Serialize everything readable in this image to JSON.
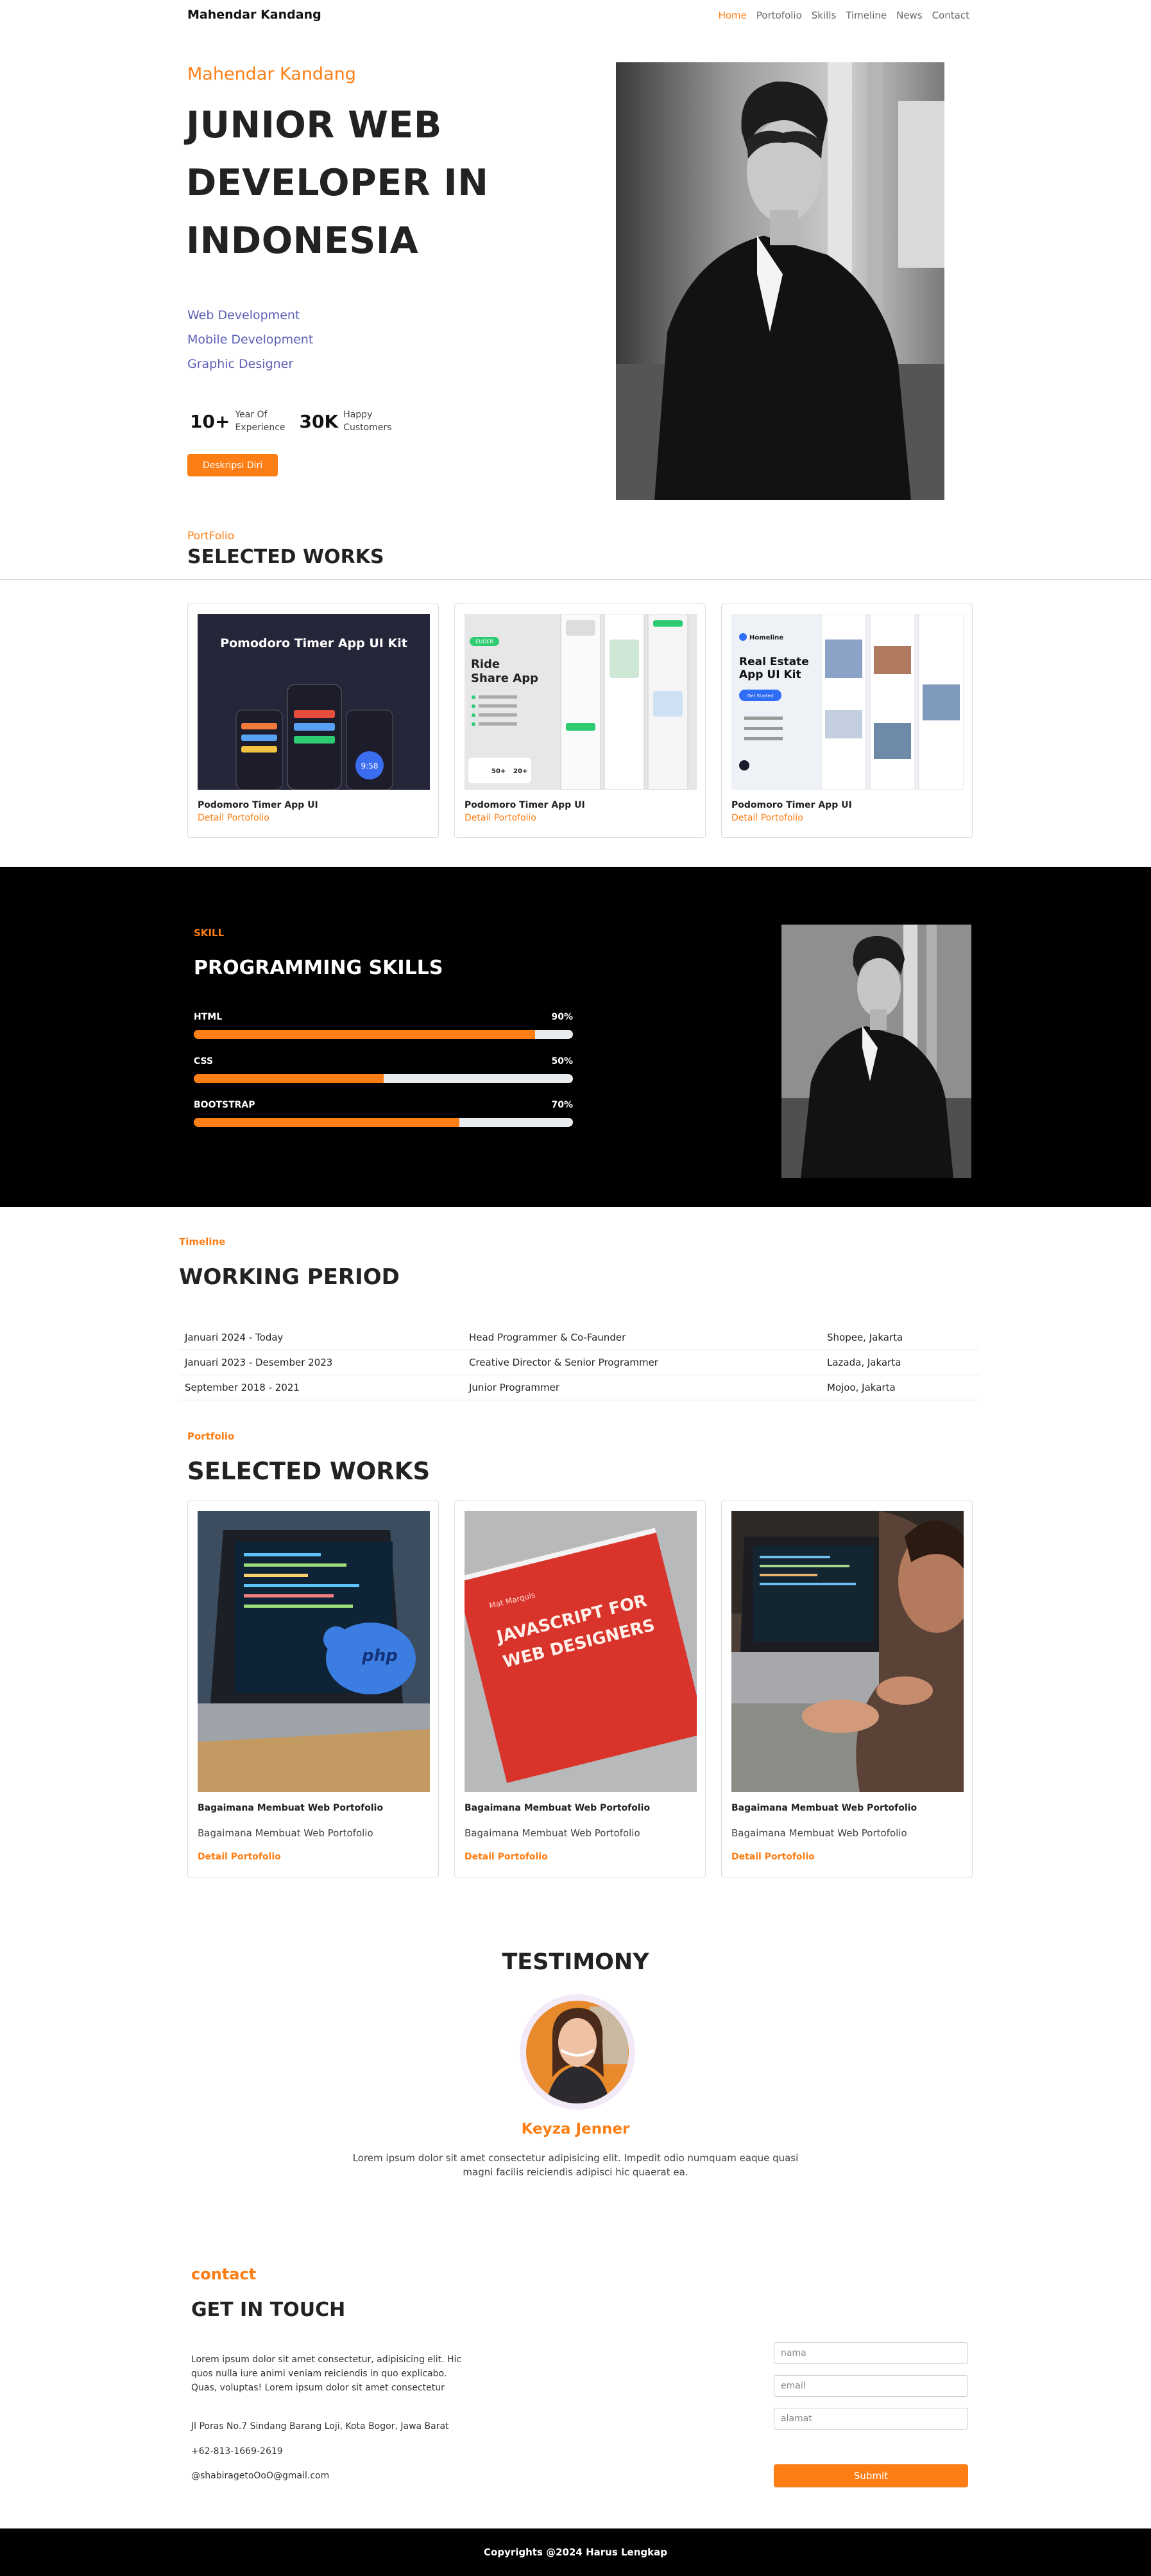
{
  "nav": {
    "brand": "Mahendar Kandang",
    "links": [
      "Home",
      "Portofolio",
      "Skills",
      "Timeline",
      "News",
      "Contact"
    ]
  },
  "hero": {
    "name": "Mahendar Kandang",
    "title": "JUNIOR WEB DEVELOPER IN INDONESIA",
    "roles": [
      "Web Development",
      "Mobile Development",
      "Graphic Designer"
    ],
    "stats": [
      {
        "value": "10+",
        "label_line1": "Year Of",
        "label_line2": "Experience"
      },
      {
        "value": "30K",
        "label_line1": "Happy",
        "label_line2": "Customers"
      }
    ],
    "button": "Deskripsi Diri"
  },
  "portfolio1": {
    "eyebrow": "PortFolio",
    "title": "SELECTED WORKS",
    "cards": [
      {
        "title": "Podomoro Timer App UI",
        "link": "Detail Portofolio",
        "thumb_heading": "Pomodoro Timer App UI  Kit",
        "thumb_time": "9:58"
      },
      {
        "title": "Podomoro Timer App UI",
        "link": "Detail Portofolio",
        "thumb_heading": "Ride Share App",
        "thumb_badge": "EUDER",
        "thumb_stat1": "50+",
        "thumb_stat2": "20+"
      },
      {
        "title": "Podomoro Timer App UI",
        "link": "Detail Portofolio",
        "thumb_heading": "Real Estate App UI Kit",
        "thumb_brand": "Homeline",
        "thumb_button": "Get Started"
      }
    ]
  },
  "skills": {
    "eyebrow": "SKILL",
    "title": "PROGRAMMING SKILLS",
    "items": [
      {
        "name": "HTML",
        "percent_label": "90%",
        "level": 0.9
      },
      {
        "name": "CSS",
        "percent_label": "50%",
        "level": 0.5
      },
      {
        "name": "BOOTSTRAP",
        "percent_label": "70%",
        "level": 0.7
      }
    ]
  },
  "timeline": {
    "eyebrow": "Timeline",
    "title": "WORKING PERIOD",
    "rows": [
      {
        "period": "Januari 2024 - Today",
        "role": "Head Programmer & Co-Faunder",
        "place": "Shopee, Jakarta"
      },
      {
        "period": "Januari 2023 - Desember 2023",
        "role": "Creative Director & Senior Programmer",
        "place": "Lazada, Jakarta"
      },
      {
        "period": "September 2018 - 2021",
        "role": "Junior Programmer",
        "place": "Mojoo, Jakarta"
      }
    ]
  },
  "portfolio2": {
    "eyebrow": "Portfolio",
    "title": "SELECTED WORKS",
    "cards": [
      {
        "title": "Bagaimana Membuat Web Portofolio",
        "desc": "Bagaimana Membuat Web Portofolio",
        "link": "Detail Portofolio",
        "photo_text": "php"
      },
      {
        "title": "Bagaimana Membuat Web Portofolio",
        "desc": "Bagaimana Membuat Web Portofolio",
        "link": "Detail Portofolio",
        "photo_text": "JAVASCRIPT FOR WEB DESIGNERS",
        "photo_small": "Mat Marquis"
      },
      {
        "title": "Bagaimana Membuat Web Portofolio",
        "desc": "Bagaimana Membuat Web Portofolio",
        "link": "Detail Portofolio"
      }
    ]
  },
  "testimony": {
    "title": "TESTIMONY",
    "name": "Keyza Jenner",
    "quote": "Lorem ipsum dolor sit amet consectetur adipisicing elit. Impedit odio numquam eaque quasi magni facilis reiciendis adipisci hic quaerat ea."
  },
  "contact": {
    "eyebrow": "contact",
    "title": "GET IN TOUCH",
    "body": "Lorem ipsum dolor sit amet consectetur, adipisicing elit. Hic quos nulla iure animi veniam reiciendis in quo explicabo. Quas, voluptas! Lorem ipsum dolor sit amet consectetur",
    "address": "Jl Poras No.7 Sindang Barang Loji, Kota Bogor, Jawa Barat",
    "phone": "+62-813-1669-2619",
    "email": "@shabiragetoOoO@gmail.com",
    "placeholders": {
      "name": "nama",
      "email": "email",
      "address": "alamat"
    },
    "submit": "Submit"
  },
  "footer": {
    "text": "Copyrights @2024 Harus Lengkap"
  },
  "colors": {
    "accent": "#fd7e14",
    "role_text": "#5b5fb4",
    "dark": "#000000"
  }
}
